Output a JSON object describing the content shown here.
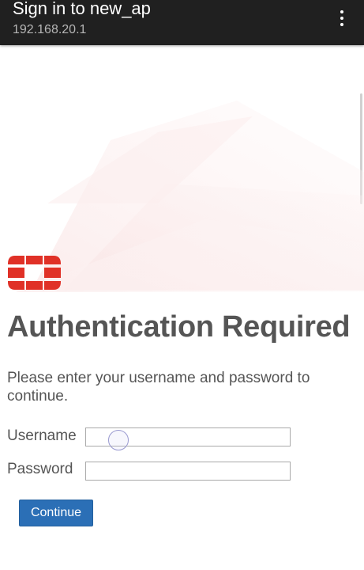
{
  "app_bar": {
    "title": "Sign in to new_ap",
    "subtitle": "192.168.20.1",
    "menu_icon": "more-vert-icon"
  },
  "colors": {
    "app_bar_bg": "#202020",
    "logo_red": "#e03127",
    "button_blue": "#2b6fb6",
    "text_gray": "#555555"
  },
  "main": {
    "logo_icon": "fortinet-logo-icon",
    "heading": "Authentication Required",
    "description": "Please enter your username and password to continue.",
    "username": {
      "label": "Username",
      "value": "",
      "placeholder": ""
    },
    "password": {
      "label": "Password",
      "value": "",
      "placeholder": ""
    },
    "continue_label": "Continue"
  }
}
